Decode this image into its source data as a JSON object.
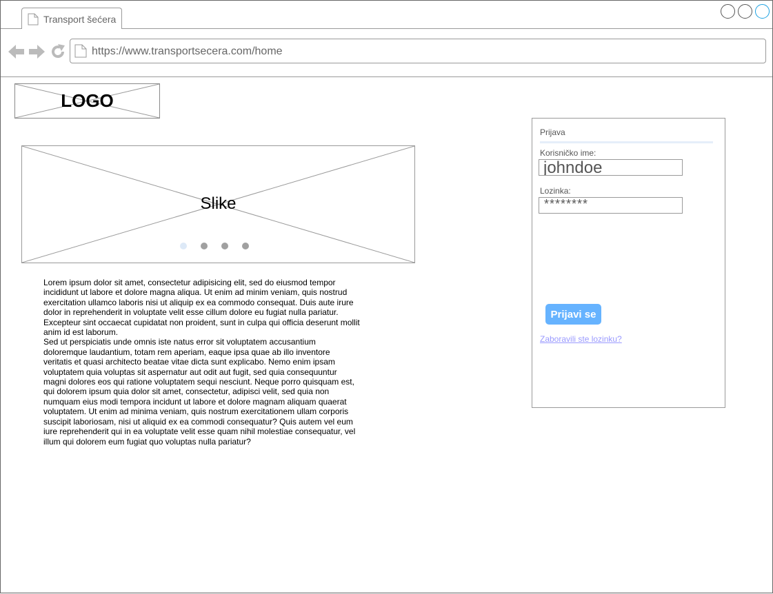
{
  "browser": {
    "tab_title": "Transport šećera",
    "url": "https://www.transportsecera.com/home"
  },
  "logo": {
    "label": "LOGO"
  },
  "carousel": {
    "label": "Slike",
    "slides": 4,
    "active_slide": 1
  },
  "content": {
    "paragraphs": [
      "Lorem ipsum dolor sit amet, consectetur adipisicing elit, sed do eiusmod tempor incididunt ut labore et dolore magna aliqua. Ut enim ad minim veniam, quis nostrud exercitation ullamco laboris nisi ut aliquip ex ea commodo consequat. Duis aute irure dolor in reprehenderit in voluptate velit esse cillum dolore eu fugiat nulla pariatur. Excepteur sint occaecat cupidatat non proident, sunt in culpa qui officia deserunt mollit anim id est laborum.",
      "Sed ut perspiciatis unde omnis iste natus error sit voluptatem accusantium doloremque laudantium, totam rem aperiam, eaque ipsa quae ab illo inventore veritatis et quasi architecto beatae vitae dicta sunt explicabo. Nemo enim ipsam voluptatem quia voluptas sit aspernatur aut odit aut fugit, sed quia consequuntur magni dolores eos qui ratione voluptatem sequi nesciunt. Neque porro quisquam est, qui dolorem ipsum quia dolor sit amet, consectetur, adipisci velit, sed quia non numquam eius modi tempora incidunt ut labore et dolore magnam aliquam quaerat voluptatem. Ut enim ad minima veniam, quis nostrum exercitationem ullam corporis suscipit laboriosam, nisi ut aliquid ex ea commodi consequatur? Quis autem vel eum iure reprehenderit qui in ea voluptate velit esse quam nihil molestiae consequatur, vel illum qui dolorem eum fugiat quo voluptas nulla pariatur?"
    ]
  },
  "login": {
    "title": "Prijava",
    "username_label": "Korisničko ime:",
    "username_value": "johndoe",
    "password_label": "Lozinka:",
    "password_value": "********",
    "submit_label": "Prijavi se",
    "forgot_label": "Zaboravili ste lozinku?"
  },
  "colors": {
    "button": "#66b3ff",
    "link": "#9999ff",
    "active_dot": "#dde9f7",
    "inactive_dot": "#a0a0a0"
  }
}
